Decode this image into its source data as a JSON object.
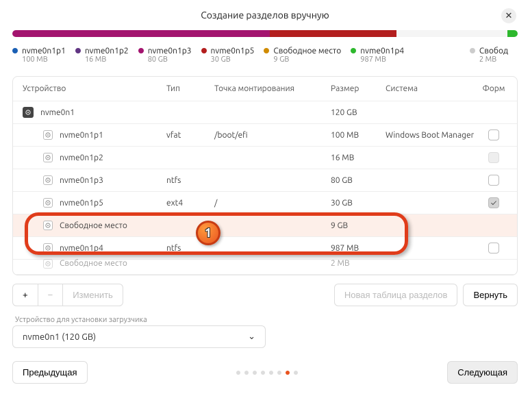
{
  "title": "Создание разделов вручную",
  "legend": [
    {
      "label": "nvme0n1p1",
      "sub": "100 MB",
      "color": "#1a5fb4"
    },
    {
      "label": "nvme0n1p2",
      "sub": "16 MB",
      "color": "#613583"
    },
    {
      "label": "nvme0n1p3",
      "sub": "80 GB",
      "color": "#a3146f"
    },
    {
      "label": "nvme0n1p5",
      "sub": "30 GB",
      "color": "#b31e1e"
    },
    {
      "label": "Свободное место",
      "sub": "9 GB",
      "color": "#d08b00"
    },
    {
      "label": "nvme0n1p4",
      "sub": "987 MB",
      "color": "#2db82d"
    },
    {
      "label": "Свобод",
      "sub": "2 MB",
      "color": ""
    }
  ],
  "columns": {
    "dev": "Устройство",
    "type": "Тип",
    "mount": "Точка монтирования",
    "size": "Размер",
    "sys": "Система",
    "fmt": "Форм"
  },
  "rows": [
    {
      "dev": "nvme0n1",
      "type": "",
      "mount": "",
      "size": "120 GB",
      "sys": "",
      "fmt": null,
      "root": true
    },
    {
      "dev": "nvme0n1p1",
      "type": "vfat",
      "mount": "/boot/efi",
      "size": "100 MB",
      "sys": "Windows Boot Manager",
      "fmt": "unchecked"
    },
    {
      "dev": "nvme0n1p2",
      "type": "",
      "mount": "",
      "size": "16 MB",
      "sys": "",
      "fmt": "disabled"
    },
    {
      "dev": "nvme0n1p3",
      "type": "ntfs",
      "mount": "",
      "size": "80 GB",
      "sys": "",
      "fmt": "unchecked"
    },
    {
      "dev": "nvme0n1p5",
      "type": "ext4",
      "mount": "/",
      "size": "30 GB",
      "sys": "",
      "fmt": "checked"
    },
    {
      "dev": "Свободное место",
      "type": "",
      "mount": "",
      "size": "9 GB",
      "sys": "",
      "fmt": null,
      "highlighted": true
    },
    {
      "dev": "nvme0n1p4",
      "type": "ntfs",
      "mount": "",
      "size": "987 MB",
      "sys": "",
      "fmt": "unchecked"
    },
    {
      "dev": "Свободное место",
      "type": "",
      "mount": "",
      "size": "2 MB",
      "sys": "",
      "fmt": null,
      "fade": true
    }
  ],
  "toolbar": {
    "add": "+",
    "remove": "−",
    "change": "Изменить",
    "newtable": "Новая таблица разделов",
    "revert": "Вернуть"
  },
  "bootloader": {
    "label": "Устройство для установки загрузчика",
    "value": "nvme0n1 (120 GB)"
  },
  "footer": {
    "prev": "Предыдущая",
    "next": "Следующая"
  },
  "annotation_badge": "1"
}
